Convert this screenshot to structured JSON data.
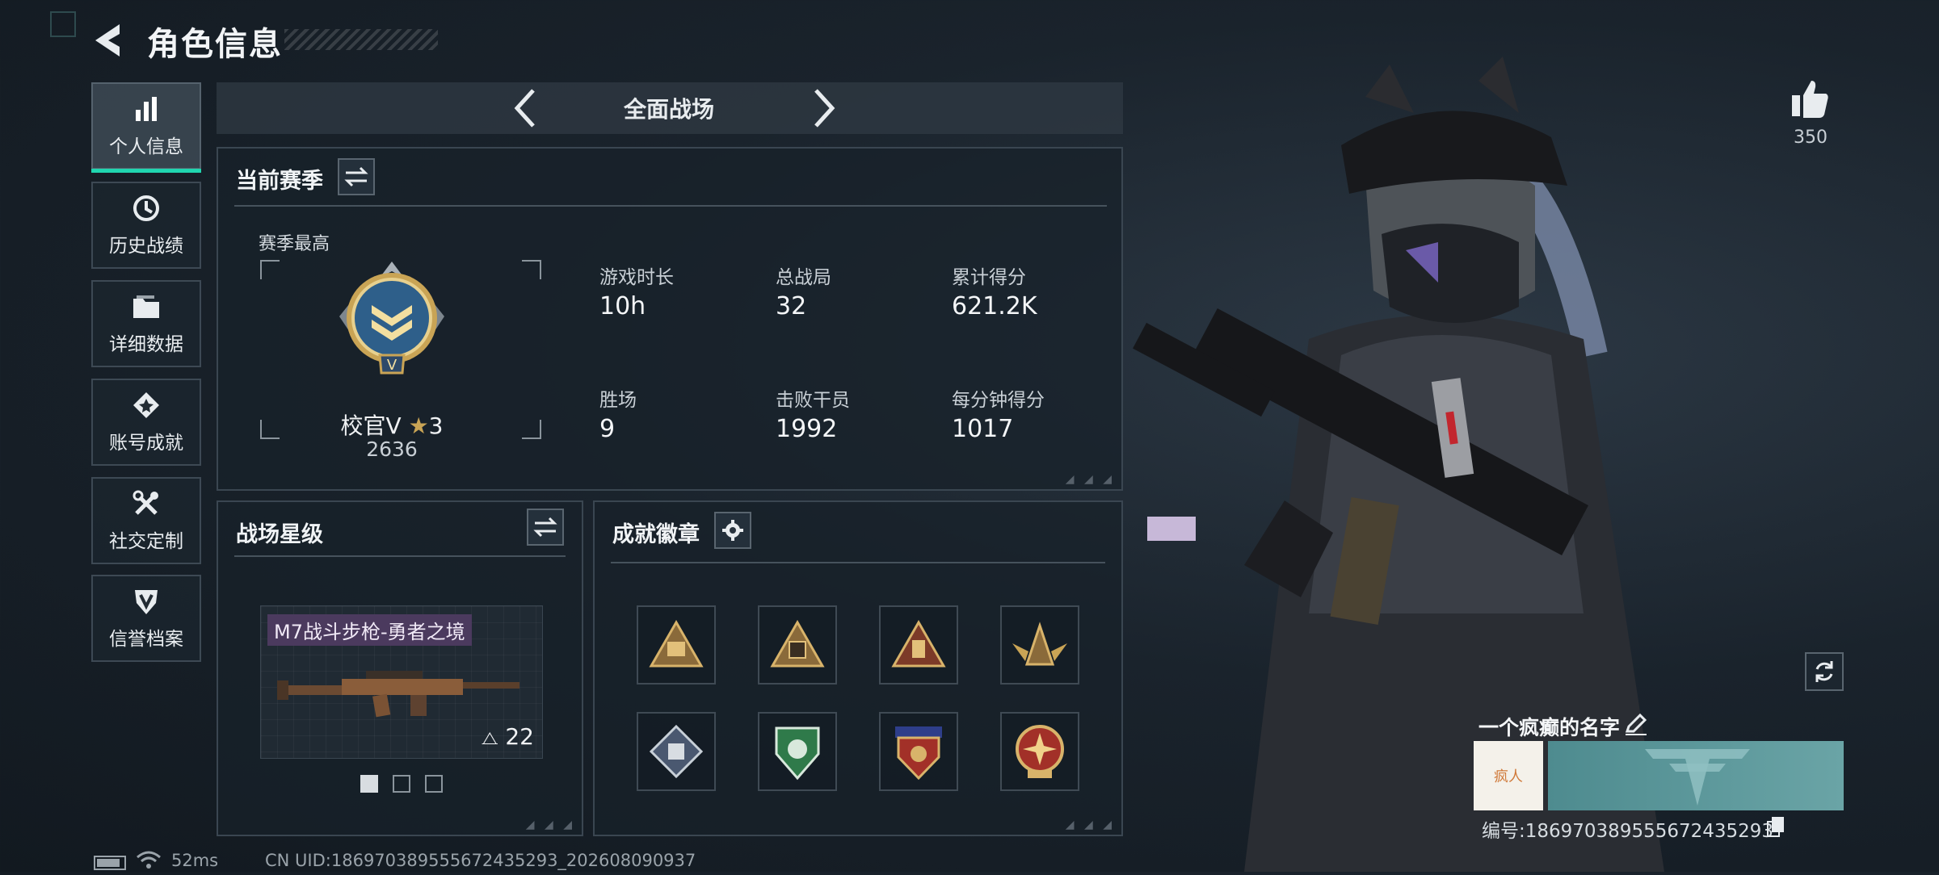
{
  "header": {
    "title": "角色信息"
  },
  "sidebar": {
    "items": [
      {
        "label": "个人信息",
        "icon": "bar-chart-icon",
        "active": true
      },
      {
        "label": "历史战绩",
        "icon": "history-icon"
      },
      {
        "label": "详细数据",
        "icon": "folder-icon"
      },
      {
        "label": "账号成就",
        "icon": "achievement-icon"
      },
      {
        "label": "社交定制",
        "icon": "tools-icon"
      },
      {
        "label": "信誉档案",
        "icon": "credit-shield-icon"
      }
    ]
  },
  "mode_selector": {
    "label": "全面战场"
  },
  "season": {
    "title": "当前赛季",
    "best_label": "赛季最高",
    "rank_name": "校官V",
    "rank_stars": "3",
    "rank_score": "2636",
    "stats": [
      {
        "label": "游戏时长",
        "value": "10h"
      },
      {
        "label": "总战局",
        "value": "32"
      },
      {
        "label": "累计得分",
        "value": "621.2K"
      },
      {
        "label": "胜场",
        "value": "9"
      },
      {
        "label": "击败干员",
        "value": "1992"
      },
      {
        "label": "每分钟得分",
        "value": "1017"
      }
    ]
  },
  "star_level": {
    "title": "战场星级",
    "weapon_name": "M7战斗步枪-勇者之境",
    "weapon_level": "22",
    "page_count": 3,
    "current_page": 1
  },
  "achievements": {
    "title": "成就徽章",
    "badges": [
      "triangle-bronze-badge",
      "triangle-sb-badge",
      "triangle-box-badge",
      "bronze-wings-badge",
      "diamond-silver-badge",
      "green-shield-badge",
      "red-stars-badge",
      "red-cross-medal-badge"
    ]
  },
  "profile": {
    "likes": "350",
    "player_name": "一个疯癫的名字",
    "player_id": "编号:1869703895556724352​93",
    "signature_text": "疯人"
  },
  "status_bar": {
    "ping": "52ms",
    "uid": "CN UID:1869703895556724352​93_202608090937"
  },
  "colors": {
    "accent": "#20d6b0",
    "panel_border": "#3a4651",
    "gold": "#c9a455"
  }
}
